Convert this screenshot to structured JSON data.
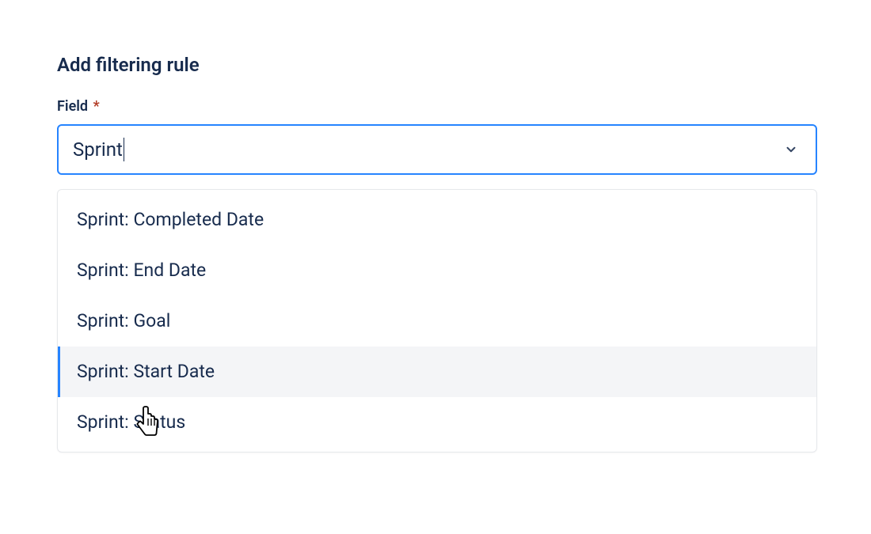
{
  "heading": "Add filtering rule",
  "field": {
    "label": "Field",
    "required_mark": "*",
    "value": "Sprint"
  },
  "options": [
    {
      "label": "Sprint: Completed Date",
      "highlighted": false
    },
    {
      "label": "Sprint: End Date",
      "highlighted": false
    },
    {
      "label": "Sprint: Goal",
      "highlighted": false
    },
    {
      "label": "Sprint: Start Date",
      "highlighted": true
    },
    {
      "label": "Sprint: Status",
      "highlighted": false
    }
  ],
  "icons": {
    "chevron_down": "chevron-down-icon",
    "cursor": "pointer-cursor-icon"
  }
}
